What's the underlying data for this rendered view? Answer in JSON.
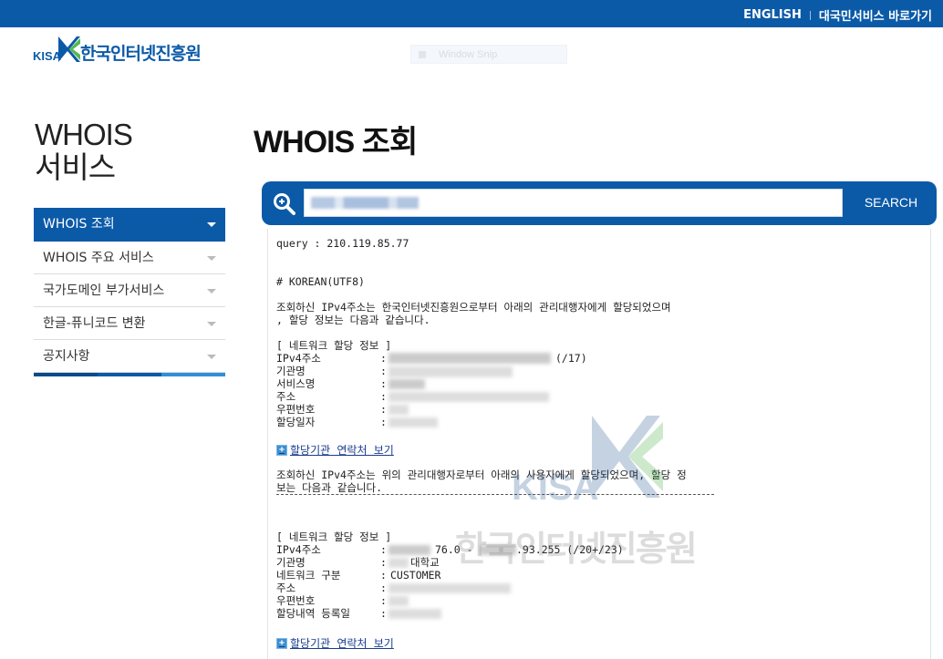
{
  "topbar": {
    "english": "ENGLISH",
    "citizen": "대국민서비스 바로가기"
  },
  "logo": {
    "kisa": "KISA",
    "name": "한국인터넷진흥원"
  },
  "snip": {
    "label": "Window Snip"
  },
  "sidebar": {
    "title_line1": "WHOIS",
    "title_line2": "서비스",
    "items": [
      {
        "label": "WHOIS 조회"
      },
      {
        "label": "WHOIS 주요 서비스"
      },
      {
        "label": "국가도메인 부가서비스"
      },
      {
        "label": "한글-퓨니코드 변환"
      },
      {
        "label": "공지사항"
      }
    ]
  },
  "main": {
    "title": "WHOIS 조회",
    "search": {
      "button": "SEARCH"
    }
  },
  "result": {
    "query_line": "query : 210.119.85.77",
    "korean_header": "# KOREAN(UTF8)",
    "intro1": "조회하신 IPv4주소는 한국인터넷진흥원으로부터 아래의 관리대행자에게 할당되었으며",
    "intro2": ", 할당 정보는 다음과 같습니다.",
    "section1_header": "[ 네트워크 할당 정보 ]",
    "s1_labels": [
      "IPv4주소",
      "기관명",
      "서비스명",
      "주소",
      "우편번호",
      "할당일자"
    ],
    "s1_ipv4_suffix": "(/17)",
    "contact_link": "할당기관 연락처 보기",
    "intro3": "조회하신 IPv4주소는 위의 관리대행자로부터 아래의 사용자에게 할당되었으며, 할당 정",
    "intro4": "보는 다음과 같습니다.",
    "section2_header": "[ 네트워크 할당 정보 ]",
    "s2_labels": [
      "IPv4주소",
      "기관명",
      "네트워크 구분",
      "주소",
      "우편번호",
      "할당내역 등록일"
    ],
    "s2_ipv4_mid": "76.0 -",
    "s2_ipv4_end": ".93.255 (/20+/23)",
    "s2_org_suffix": "대학교",
    "s2_network_type": "CUSTOMER",
    "contact_link2": "할당기관 연락처 보기"
  },
  "watermark": {
    "kisa": "KISA",
    "name": "한국인터넷진흥원"
  },
  "colors": {
    "brand": "#0b5aa8",
    "accent_green": "#3aa93a",
    "link": "#1a3d8f"
  }
}
